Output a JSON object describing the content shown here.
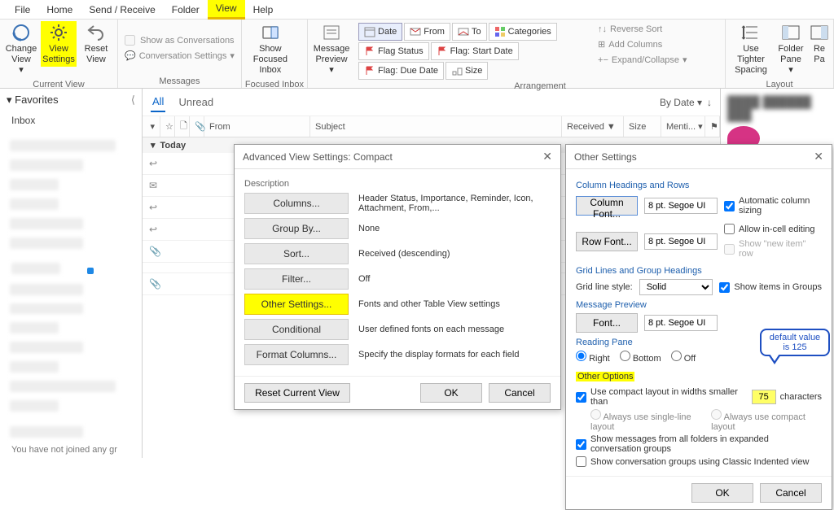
{
  "menubar": {
    "items": [
      "File",
      "Home",
      "Send / Receive",
      "Folder",
      "View",
      "Help"
    ],
    "active_index": 4
  },
  "ribbon": {
    "current_view": {
      "change_view": "Change View",
      "view_settings": "View Settings",
      "reset_view": "Reset View",
      "label": "Current View"
    },
    "messages": {
      "show_as_conv": "Show as Conversations",
      "conv_settings": "Conversation Settings",
      "label": "Messages"
    },
    "focused": {
      "btn": "Show Focused Inbox",
      "label": "Focused Inbox"
    },
    "preview": {
      "btn": "Message Preview",
      "label": ""
    },
    "arrangement": {
      "items": [
        "Date",
        "From",
        "To",
        "Categories",
        "Flag Status",
        "Flag: Start Date",
        "Flag: Due Date",
        "Size"
      ],
      "reverse": "Reverse Sort",
      "add_cols": "Add Columns",
      "expand": "Expand/Collapse",
      "label": "Arrangement"
    },
    "layout": {
      "tighter": "Use Tighter Spacing",
      "folder": "Folder Pane",
      "reading": "Re Pa",
      "label": "Layout"
    }
  },
  "sidebar": {
    "favorites": "Favorites",
    "inbox": "Inbox",
    "bottom_note": "You have not joined any gr"
  },
  "list": {
    "tabs": [
      "All",
      "Unread"
    ],
    "sort_by": "By Date",
    "cols": {
      "from": "From",
      "subject": "Subject",
      "received": "Received",
      "size": "Size",
      "mention": "Menti..."
    },
    "group_today": "Today"
  },
  "dialog_avs": {
    "title": "Advanced View Settings: Compact",
    "section": "Description",
    "rows": [
      {
        "btn": "Columns...",
        "desc": "Header Status, Importance, Reminder, Icon, Attachment, From,..."
      },
      {
        "btn": "Group By...",
        "desc": "None"
      },
      {
        "btn": "Sort...",
        "desc": "Received (descending)"
      },
      {
        "btn": "Filter...",
        "desc": "Off"
      },
      {
        "btn": "Other Settings...",
        "desc": "Fonts and other Table View settings",
        "hl": true
      },
      {
        "btn": "Conditional Formatting...",
        "desc": "User defined fonts on each message"
      },
      {
        "btn": "Format Columns...",
        "desc": "Specify the display formats for each field"
      }
    ],
    "reset": "Reset Current View",
    "ok": "OK",
    "cancel": "Cancel"
  },
  "dialog_os": {
    "title": "Other Settings",
    "sec_ch": "Column Headings and Rows",
    "col_font_btn": "Column Font...",
    "col_font_val": "8 pt. Segoe UI",
    "row_font_btn": "Row Font...",
    "row_font_val": "8 pt. Segoe UI",
    "auto_sizing": "Automatic column sizing",
    "in_cell": "Allow in-cell editing",
    "new_item": "Show \"new item\" row",
    "sec_grid": "Grid Lines and Group Headings",
    "grid_label": "Grid line style:",
    "grid_val": "Solid",
    "show_groups": "Show items in Groups",
    "sec_mp": "Message Preview",
    "mp_font": "Font...",
    "mp_val": "8 pt. Segoe UI",
    "sec_rp": "Reading Pane",
    "rp_opts": [
      "Right",
      "Bottom",
      "Off"
    ],
    "sec_oo": "Other Options",
    "compact_prefix": "Use compact layout in widths smaller than",
    "compact_val": "75",
    "compact_suffix": "characters",
    "always_single": "Always use single-line layout",
    "always_compact": "Always use compact layout",
    "show_expanded": "Show messages from all folders in expanded conversation groups",
    "classic": "Show conversation groups using Classic Indented view",
    "ok": "OK",
    "cancel": "Cancel",
    "callout": "default value is 125"
  }
}
